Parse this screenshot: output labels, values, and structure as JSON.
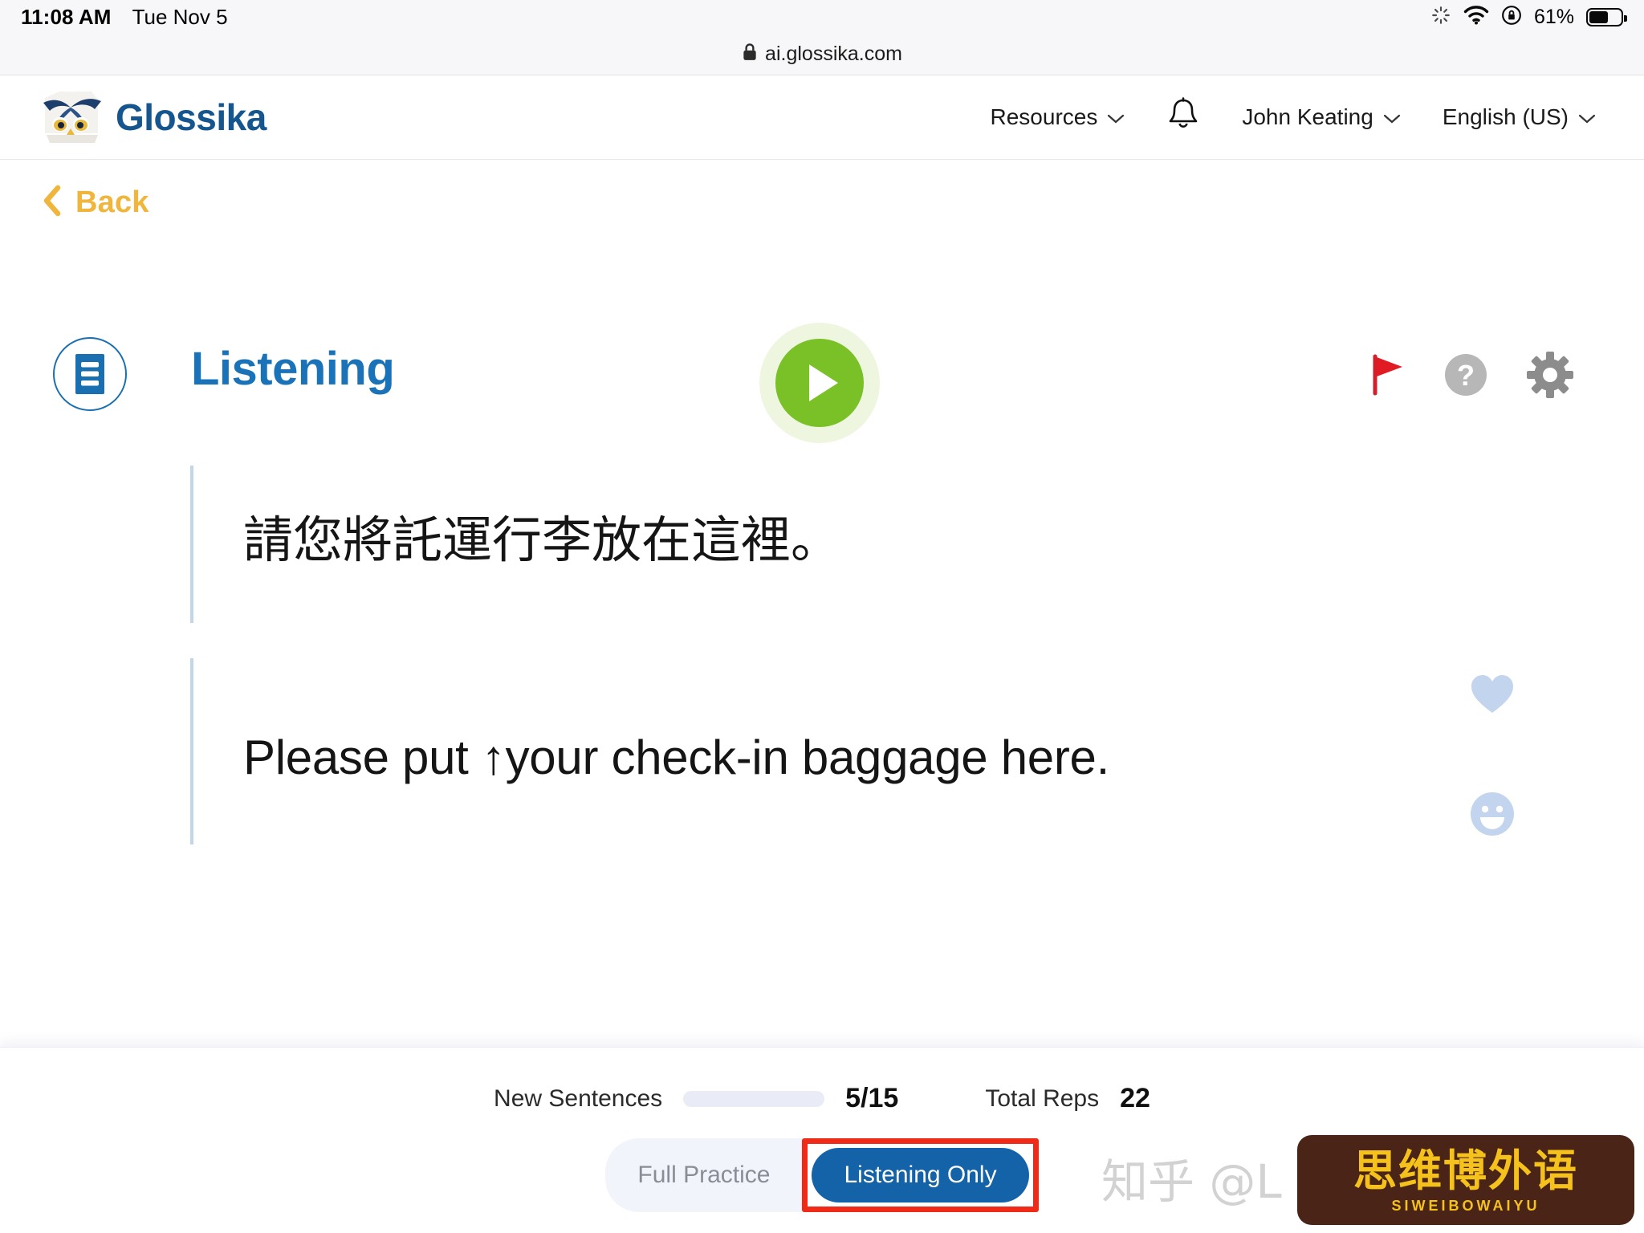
{
  "status_bar": {
    "time": "11:08 AM",
    "date": "Tue Nov 5",
    "battery_percent": "61%",
    "battery_level": 61,
    "icons": [
      "activity-spinner-icon",
      "wifi-icon",
      "rotation-lock-icon",
      "battery-icon"
    ]
  },
  "browser": {
    "url": "ai.glossika.com",
    "lock_icon": "lock-icon"
  },
  "header": {
    "brand_name": "Glossika",
    "logo_icon": "owl-logo-icon",
    "nav": [
      {
        "label": "Resources",
        "has_caret": true,
        "caret": "⌄"
      },
      {
        "label": "",
        "icon": "bell-icon",
        "has_caret": false
      },
      {
        "label": "John Keating",
        "has_caret": true,
        "caret": "⌄"
      },
      {
        "label": "English (US)",
        "has_caret": true,
        "caret": "⌄"
      }
    ]
  },
  "back": {
    "label": "Back",
    "icon": "chevron-left-icon",
    "color": "#f0b63c"
  },
  "practice": {
    "mode_title": "Listening",
    "mode_icon": "list-document-icon",
    "title_color": "#1a73b8",
    "play_icon": "play-icon",
    "play_color": "#79c127",
    "tools": [
      {
        "name": "flag-icon",
        "color": "#e01b24"
      },
      {
        "name": "help-icon",
        "color": "#b3b3b3",
        "glyph": "?"
      },
      {
        "name": "gear-icon",
        "color": "#8c8c8c"
      }
    ]
  },
  "sentences": {
    "source": "請您將託運行李放在這裡。",
    "target": "Please put ↑your check-in baggage here.",
    "accent_color": "#c2d6ea"
  },
  "reactions": [
    {
      "name": "heart-icon",
      "color": "#c3d4ee"
    },
    {
      "name": "smiley-icon",
      "color": "#c3d4ee"
    }
  ],
  "footer": {
    "new_sentences_label": "New Sentences",
    "new_sentences_value": "5/15",
    "new_sentences_progress": 33,
    "total_reps_label": "Total Reps",
    "total_reps_value": "22",
    "progress_color": "#f2a007",
    "toggle": {
      "inactive_label": "Full Practice",
      "active_label": "Listening Only",
      "active_color": "#1463a8",
      "highlight_color": "#ef2b17"
    }
  },
  "watermarks": {
    "zhihu": "知乎 @L",
    "badge_main": "思维博外语",
    "badge_sub": "SIWEIBOWAIYU",
    "badge_bg": "#4a2416",
    "badge_fg": "#f5c21b"
  }
}
